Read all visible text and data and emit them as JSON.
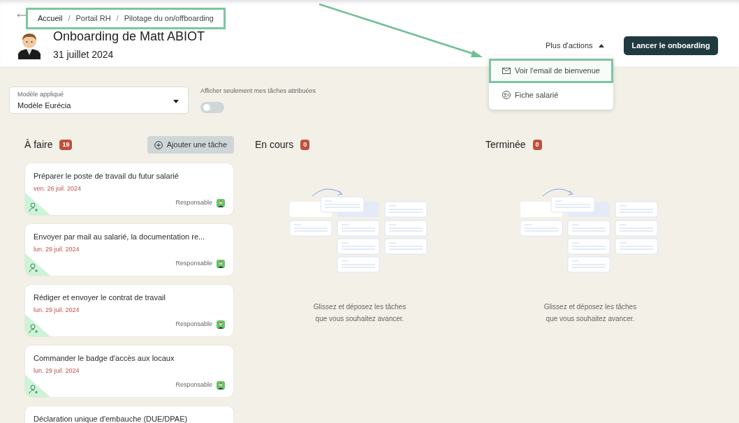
{
  "breadcrumb": {
    "highlighted": true,
    "separator": "/",
    "items": [
      "Accueil",
      "Portail RH",
      "Pilotage du on/offboarding"
    ]
  },
  "title": "Onboarding de Matt ABIOT",
  "date": "31 juillet 2024",
  "more_actions": {
    "label": "Plus d'actions",
    "expanded": true
  },
  "primary_button": "Lancer le onboarding",
  "menu": [
    {
      "label": "Voir l'email de bienvenue",
      "kind": "email",
      "highlighted": true
    },
    {
      "label": "Fiche salarié",
      "kind": "employee",
      "highlighted": false
    }
  ],
  "template_select": {
    "label": "Modèle appliqué",
    "value": "Modèle Eurécia"
  },
  "filter_toggle": {
    "label": "Afficher seulement mes tâches attribuées",
    "on": false
  },
  "columns": [
    {
      "title": "À faire",
      "count": "19",
      "add_button": "Ajouter une tâche",
      "tasks": [
        {
          "title": "Préparer le poste de travail du futur salarié",
          "date": "ven. 26 juil. 2024",
          "assignee_label": "Responsable"
        },
        {
          "title": "Envoyer par mail au salarié, la documentation re...",
          "date": "lun. 29 juil. 2024",
          "assignee_label": "Responsable"
        },
        {
          "title": "Rédiger et envoyer le contrat de travail",
          "date": "lun. 29 juil. 2024",
          "assignee_label": "Responsable"
        },
        {
          "title": "Commander le badge d'accès aux locaux",
          "date": "lun. 29 juil. 2024",
          "assignee_label": "Responsable"
        },
        {
          "title": "Déclaration unique d'embauche (DUE/DPAE)"
        }
      ]
    },
    {
      "title": "En cours",
      "count": "0",
      "empty_text": "Glissez et déposez les tâches\nque vous souhaitez avancer."
    },
    {
      "title": "Terminée",
      "count": "0",
      "empty_text": "Glissez et déposez les tâches\nque vous souhaitez avancer."
    }
  ]
}
